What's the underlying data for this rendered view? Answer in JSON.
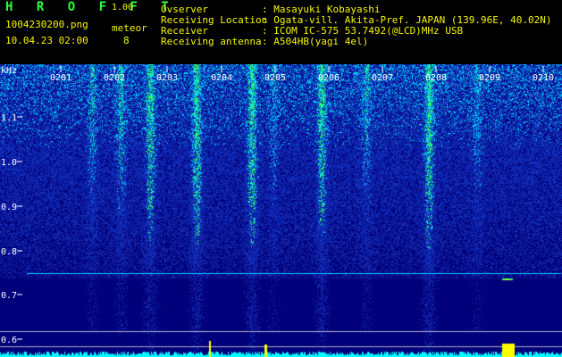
{
  "header": {
    "logo": "H R O F F T",
    "version": "1.00",
    "filename": "1004230200.png",
    "meteor_label": "meteor",
    "datetime": "10.04.23 02:00",
    "meteor_count": "8",
    "info": [
      {
        "label": "Ovserver",
        "value": ": Masayuki Kobayashi"
      },
      {
        "label": "Receiving Location",
        "value": ": Ogata-vill. Akita-Pref. JAPAN (139.96E, 40.02N)"
      },
      {
        "label": "Receiver",
        "value": ": ICOM IC-575 53.7492(@LCD)MHz USB"
      },
      {
        "label": "Receiving antenna",
        "value": ": A504HB(yagi 4el)"
      }
    ]
  },
  "spectrogram": {
    "y_unit": "kHz",
    "time_ticks": [
      "0201",
      "0202",
      "0203",
      "0204",
      "0205",
      "0206",
      "0207",
      "0208",
      "0209",
      "0210"
    ],
    "freq_ticks": [
      "1.1",
      "1.0",
      "0.9",
      "0.8",
      "0.7",
      "0.6"
    ],
    "colors": {
      "background": "#00007a",
      "noise_low": "#1030c0",
      "noise_high": "#00d8ff",
      "meteor": "#30ff60",
      "carrier": "#00c8ff",
      "baseline": "#00ffff",
      "flash": "#ffff00"
    }
  }
}
